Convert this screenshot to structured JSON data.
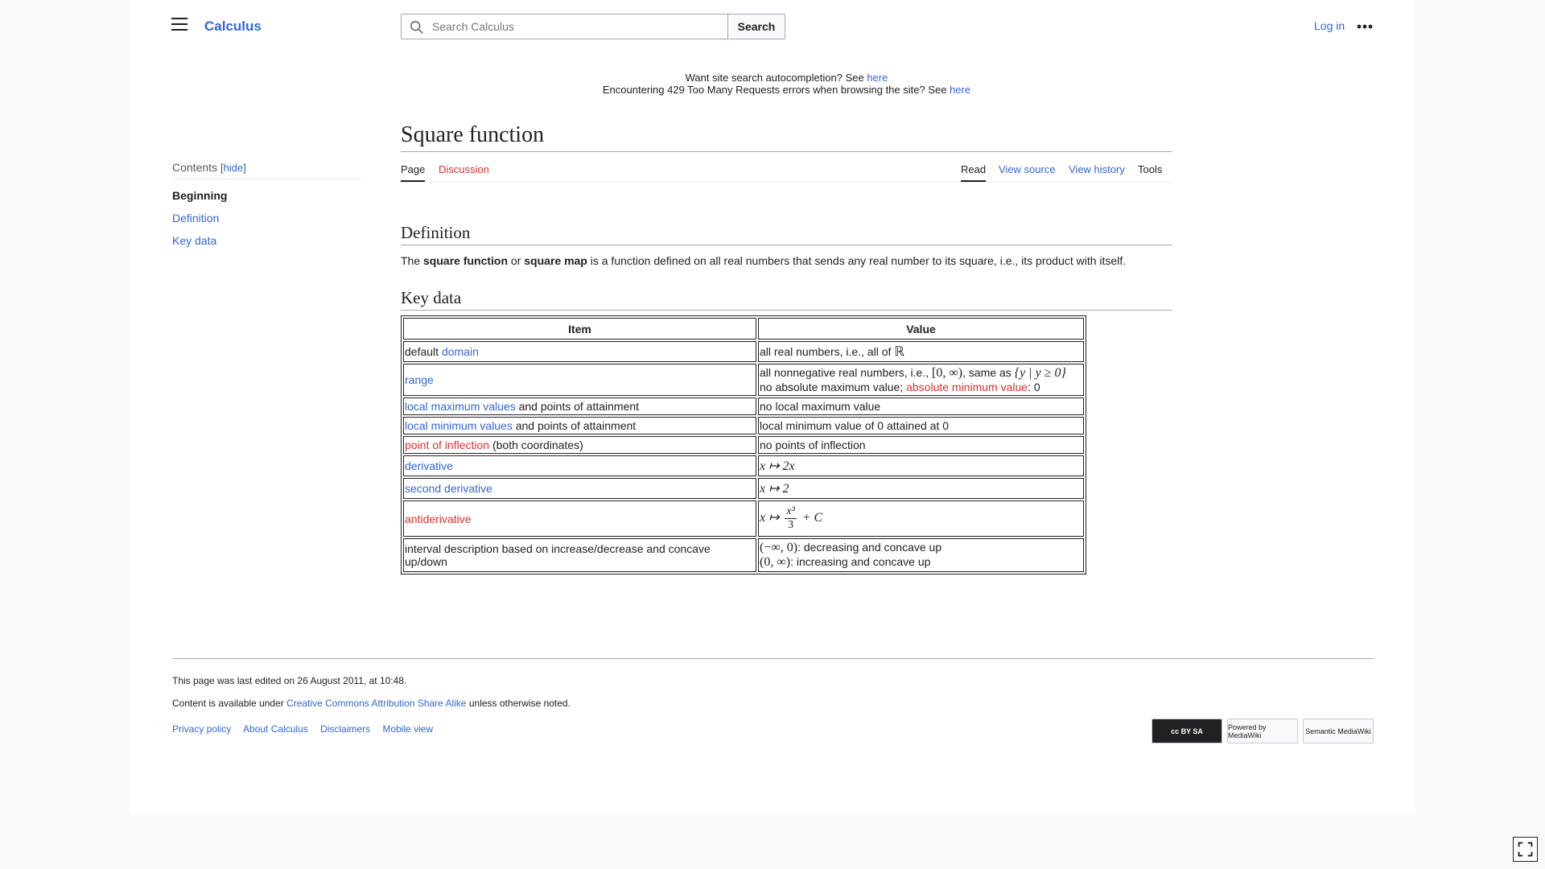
{
  "header": {
    "site_title": "Calculus",
    "search_placeholder": "Search Calculus",
    "search_button": "Search",
    "login": "Log in"
  },
  "notice": {
    "line1_text": "Want site search autocompletion? See ",
    "line1_link": "here",
    "line2_text": "Encountering 429 Too Many Requests errors when browsing the site? See ",
    "line2_link": "here"
  },
  "toc": {
    "title": "Contents",
    "hide": "hide",
    "items": [
      "Beginning",
      "Definition",
      "Key data"
    ]
  },
  "page_title": "Square function",
  "tabs": {
    "page": "Page",
    "discussion": "Discussion",
    "read": "Read",
    "view_source": "View source",
    "view_history": "View history",
    "tools": "Tools"
  },
  "definition": {
    "heading": "Definition",
    "t1": "The ",
    "b1": "square function",
    "t2": " or ",
    "b2": "square map",
    "t3": " is a function defined on all real numbers that sends any real number to its square, i.e., its product with itself."
  },
  "key_data": {
    "heading": "Key data",
    "col_item": "Item",
    "col_value": "Value",
    "rows": {
      "domain": {
        "prefix": "default ",
        "link": "domain",
        "value": "all real numbers, i.e., all of ",
        "value_math": "ℝ"
      },
      "range": {
        "link": "range",
        "v1": "all nonnegative real numbers, i.e., ",
        "m1": "[0, ∞)",
        "v2": ", same as ",
        "m2": "{y | y ≥ 0}",
        "v3": "no absolute maximum value; ",
        "v3_link": "absolute minimum value",
        "v4": ": 0"
      },
      "local_max": {
        "link": "local maximum values",
        "suffix": " and points of attainment",
        "value": "no local maximum value"
      },
      "local_min": {
        "link": "local minimum values",
        "suffix": " and points of attainment",
        "value": "local minimum value of 0 attained at 0"
      },
      "inflection": {
        "link": "point of inflection",
        "suffix": " (both coordinates)",
        "value": "no points of inflection"
      },
      "derivative": {
        "link": "derivative",
        "value": "x ↦ 2x"
      },
      "second_derivative": {
        "link": "second derivative",
        "value": "x ↦ 2"
      },
      "antiderivative": {
        "link": "antiderivative",
        "lead": "x ↦",
        "num": "x³",
        "den": "3",
        "tail": "+ C"
      },
      "intervals": {
        "item": "interval description based on increase/decrease and concave up/down",
        "m1": "(−∞, 0)",
        "v1": ": decreasing and concave up",
        "m2": "(0, ∞)",
        "v2": ": increasing and concave up"
      }
    }
  },
  "footer": {
    "edited": "This page was last edited on 26 August 2011, at 10:48.",
    "license_pre": "Content is available under ",
    "license_link": "Creative Commons Attribution Share Alike",
    "license_post": " unless otherwise noted.",
    "links": [
      "Privacy policy",
      "About Calculus",
      "Disclaimers",
      "Mobile view"
    ],
    "badges": [
      "cc BY SA",
      "Powered by MediaWiki",
      "Semantic MediaWiki"
    ]
  }
}
